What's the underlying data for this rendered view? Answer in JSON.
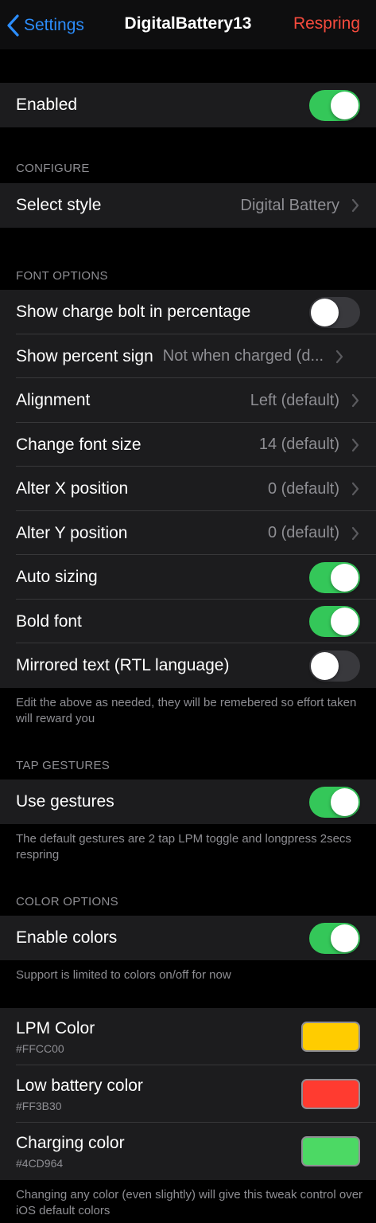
{
  "nav": {
    "back_label": "Settings",
    "title": "DigitalBattery13",
    "right_label": "Respring"
  },
  "enabled": {
    "label": "Enabled",
    "on": true
  },
  "configure": {
    "header": "CONFIGURE",
    "select_style": {
      "label": "Select style",
      "value": "Digital Battery"
    }
  },
  "font_options": {
    "header": "FONT OPTIONS",
    "show_bolt": {
      "label": "Show charge bolt in percentage",
      "on": false
    },
    "percent_sign": {
      "label": "Show percent sign",
      "value": "Not when charged (d..."
    },
    "alignment": {
      "label": "Alignment",
      "value": "Left (default)"
    },
    "font_size": {
      "label": "Change font size",
      "value": "14 (default)"
    },
    "x_position": {
      "label": "Alter X position",
      "value": "0 (default)"
    },
    "y_position": {
      "label": "Alter Y position",
      "value": "0 (default)"
    },
    "auto_sizing": {
      "label": "Auto sizing",
      "on": true
    },
    "bold_font": {
      "label": "Bold font",
      "on": true
    },
    "mirrored": {
      "label": "Mirrored text (RTL language)",
      "on": false
    },
    "footer": "Edit the above as needed, they will be remebered so effort taken will reward you"
  },
  "tap_gestures": {
    "header": "TAP GESTURES",
    "use_gestures": {
      "label": "Use gestures",
      "on": true
    },
    "footer": "The default gestures are 2 tap LPM toggle and longpress 2secs respring"
  },
  "color_options": {
    "header": "COLOR OPTIONS",
    "enable_colors": {
      "label": "Enable colors",
      "on": true
    },
    "footer": "Support is limited to colors on/off for now"
  },
  "colors": {
    "lpm": {
      "label": "LPM Color",
      "hex": "#FFCC00"
    },
    "low_battery": {
      "label": "Low battery color",
      "hex": "#FF3B30"
    },
    "charging": {
      "label": "Charging color",
      "hex": "#4CD964"
    },
    "footer": "Changing any color (even slightly) will give this tweak control over iOS default colors"
  },
  "theme": {
    "accent_blue": "#2C8DFB",
    "respring_red": "#F64B3D",
    "toggle_on": "#34C759"
  }
}
